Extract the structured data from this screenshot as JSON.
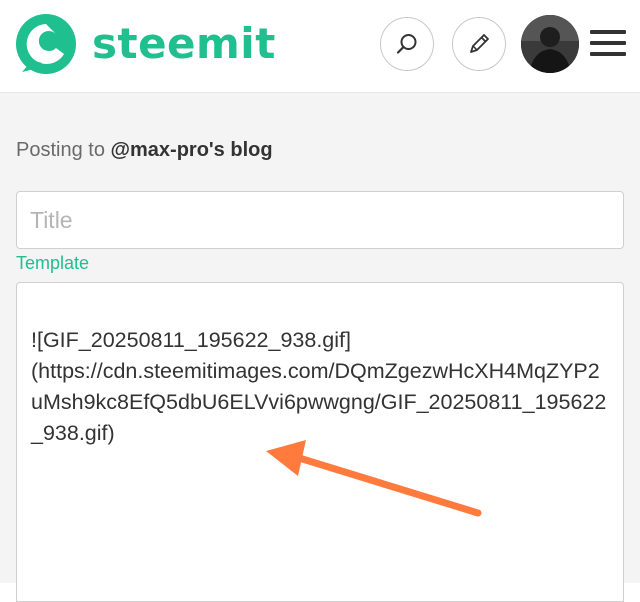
{
  "header": {
    "brand": "steemit",
    "logo_icon": "steemit-logo-icon",
    "search_icon": "search-icon",
    "edit_icon": "pencil-icon",
    "menu_icon": "hamburger-menu-icon",
    "brand_color": "#1fbf8f"
  },
  "editor": {
    "posting_prefix": "Posting to ",
    "blog_name": "@max-pro's blog",
    "title_placeholder": "Title",
    "template_label": "Template",
    "body_text": "![GIF_20250811_195622_938.gif]\n(https://cdn.steemitimages.com/DQmZgezwHcXH4MqZYP2uMsh9kc8EfQ5dbU6ELVvi6pwwgng/GIF_20250811_195622_938.gif)"
  },
  "annotation": {
    "arrow_color": "#ff7a3d"
  }
}
